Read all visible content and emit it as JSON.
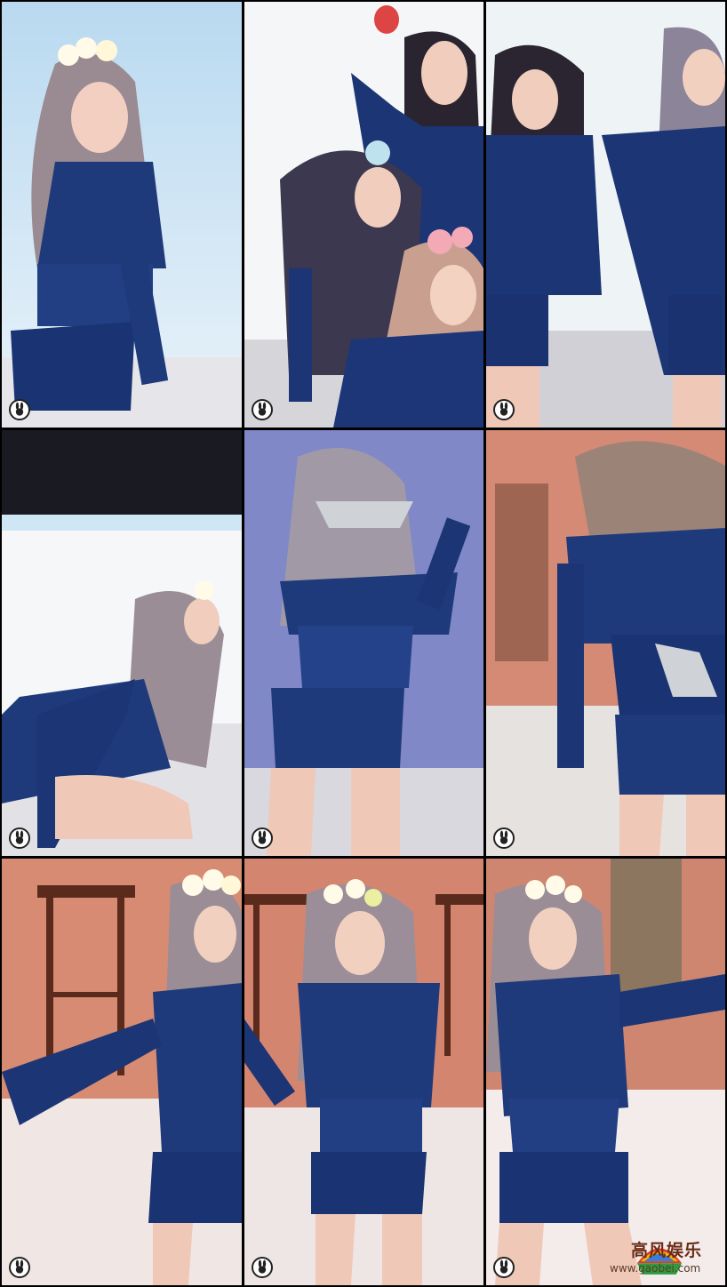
{
  "watermark": {
    "title": "高风娱乐",
    "url": "www.gaobei.com"
  },
  "panels": [
    {
      "scene": "dancer-white-flowers-front"
    },
    {
      "scene": "group-three-dancers"
    },
    {
      "scene": "two-dancers-side"
    },
    {
      "scene": "dancer-bending-side"
    },
    {
      "scene": "dancer-back-view"
    },
    {
      "scene": "dancer-back-hair-flip"
    },
    {
      "scene": "dancer-stool-background-left"
    },
    {
      "scene": "dancer-stool-background-center"
    },
    {
      "scene": "dancer-stool-background-right"
    }
  ],
  "colors": {
    "outfit": "#1f3a7a",
    "outfit_dark": "#142a5c",
    "skin": "#f0c8b8",
    "hair": "#9a8a90",
    "bg_sky": "#cfe6f5",
    "bg_stage": "#d8866a",
    "border": "#000000"
  }
}
